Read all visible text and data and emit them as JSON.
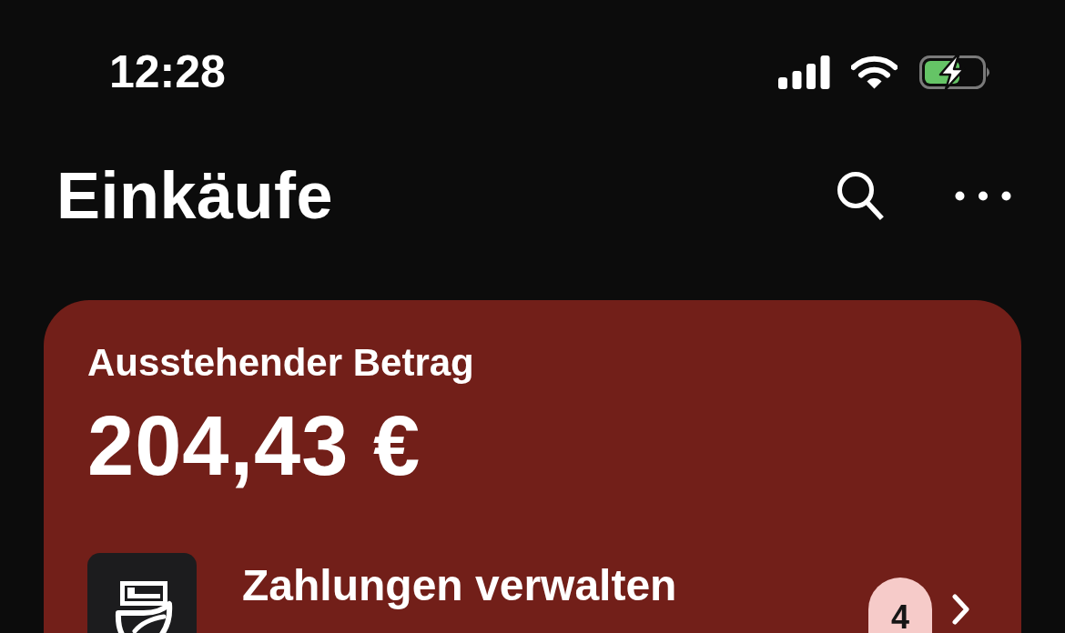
{
  "status_bar": {
    "time": "12:28",
    "battery_charging": true
  },
  "header": {
    "title": "Einkäufe"
  },
  "balance_card": {
    "label": "Ausstehender Betrag",
    "amount": "204,43 €",
    "rows": [
      {
        "title": "Zahlungen verwalten",
        "count": "4"
      }
    ]
  }
}
